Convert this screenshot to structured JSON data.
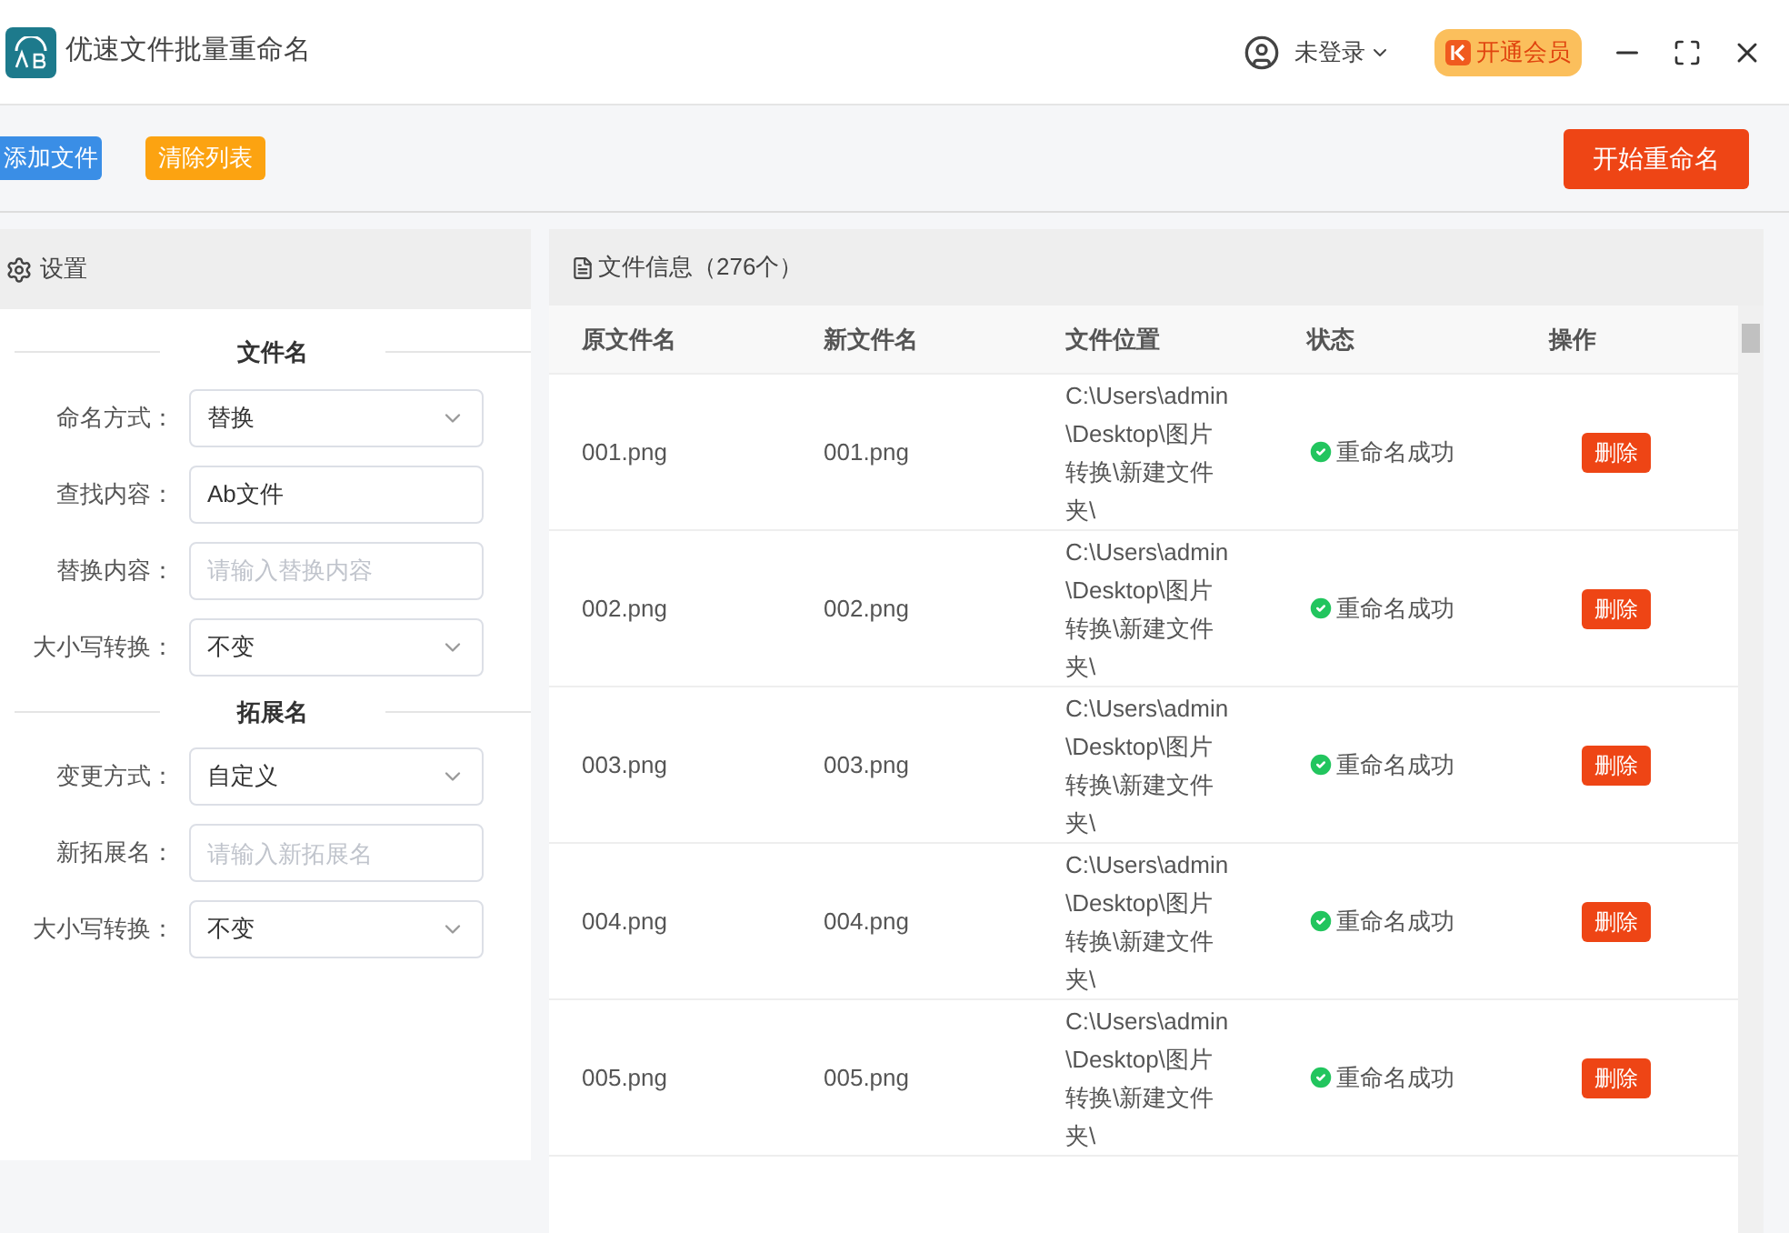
{
  "window": {
    "title": "优速文件批量重命名",
    "user": "未登录",
    "vip": "开通会员"
  },
  "toolbar": {
    "add": "添加文件",
    "clear": "清除列表",
    "start": "开始重命名"
  },
  "settings": {
    "title": "设置",
    "sections": [
      {
        "heading": "文件名",
        "fields": [
          {
            "kind": "select",
            "label": "命名方式：",
            "value": "替换"
          },
          {
            "kind": "input",
            "label": "查找内容：",
            "value": "Ab文件"
          },
          {
            "kind": "input",
            "label": "替换内容：",
            "placeholder": "请输入替换内容"
          },
          {
            "kind": "select",
            "label": "大小写转换：",
            "value": "不变"
          }
        ]
      },
      {
        "heading": "拓展名",
        "fields": [
          {
            "kind": "select",
            "label": "变更方式：",
            "value": "自定义"
          },
          {
            "kind": "input",
            "label": "新拓展名：",
            "placeholder": "请输入新拓展名"
          },
          {
            "kind": "select",
            "label": "大小写转换：",
            "value": "不变"
          }
        ]
      }
    ]
  },
  "table": {
    "title": "文件信息（276个）",
    "columns": [
      "原文件名",
      "新文件名",
      "文件位置",
      "状态",
      "操作"
    ],
    "rows": [
      {
        "original": "001.png",
        "new": "001.png",
        "location": "C:\\Users\\admin\\Desktop\\图片转换\\新建文件夹\\",
        "status": "重命名成功",
        "action": "删除"
      },
      {
        "original": "002.png",
        "new": "002.png",
        "location": "C:\\Users\\admin\\Desktop\\图片转换\\新建文件夹\\",
        "status": "重命名成功",
        "action": "删除"
      },
      {
        "original": "003.png",
        "new": "003.png",
        "location": "C:\\Users\\admin\\Desktop\\图片转换\\新建文件夹\\",
        "status": "重命名成功",
        "action": "删除"
      },
      {
        "original": "004.png",
        "new": "004.png",
        "location": "C:\\Users\\admin\\Desktop\\图片转换\\新建文件夹\\",
        "status": "重命名成功",
        "action": "删除"
      },
      {
        "original": "005.png",
        "new": "005.png",
        "location": "C:\\Users\\admin\\Desktop\\图片转换\\新建文件夹\\",
        "status": "重命名成功",
        "action": "删除"
      }
    ]
  }
}
